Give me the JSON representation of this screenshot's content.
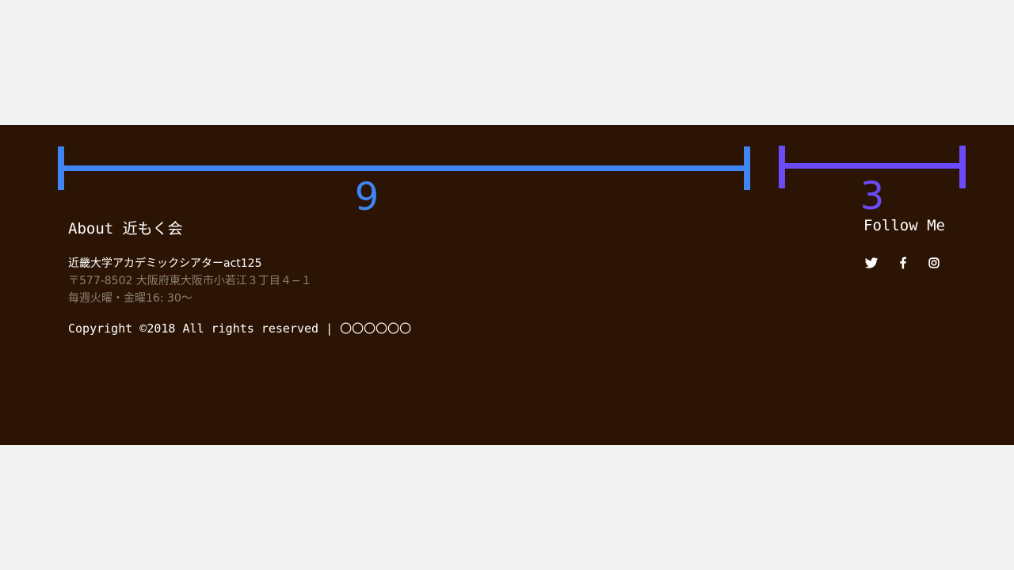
{
  "indicators": {
    "main_column": "9",
    "side_column": "3"
  },
  "footer": {
    "about": {
      "title": "About 近もく会",
      "org_name": "近畿大学アカデミックシアターact125",
      "address": "〒577-8502 大阪府東大阪市小若江３丁目４−１",
      "schedule": "毎週火曜・金曜16: 30〜"
    },
    "copyright": "Copyright ©2018 All rights reserved | 〇〇〇〇〇〇",
    "follow": {
      "title": "Follow Me",
      "icons": [
        "twitter-icon",
        "facebook-icon",
        "instagram-icon"
      ]
    }
  },
  "colors": {
    "page_background": "#f2f2f2",
    "footer_background": "#2c1404",
    "indicator_blue": "#3f85f4",
    "indicator_purple": "#6b4af7",
    "muted_text": "#8a8075"
  }
}
